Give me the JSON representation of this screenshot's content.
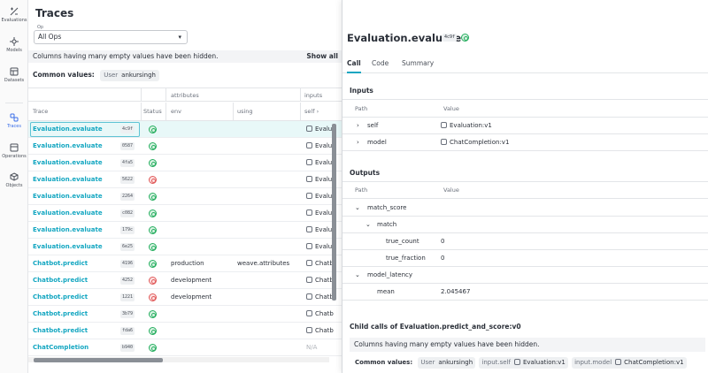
{
  "rail": [
    {
      "label": "Evaluations",
      "icon": "evaluations-icon"
    },
    {
      "label": "Models",
      "icon": "models-icon"
    },
    {
      "label": "Datasets",
      "icon": "datasets-icon"
    },
    {
      "label": "Traces",
      "icon": "traces-icon"
    },
    {
      "label": "Operations",
      "icon": "operations-icon"
    },
    {
      "label": "Objects",
      "icon": "objects-icon"
    }
  ],
  "traces": {
    "title": "Traces",
    "op_label": "Op",
    "op_value": "All Ops",
    "banner": "Columns having many empty values have been hidden.",
    "show_all": "Show all",
    "common_values_label": "Common values:",
    "common_chip_key": "User",
    "common_chip_value": "ankursingh",
    "group_attributes": "attributes",
    "group_inputs": "inputs",
    "col_trace": "Trace",
    "col_status": "Status",
    "col_env": "env",
    "col_using": "using",
    "col_self": "self",
    "rows": [
      {
        "name": "Evaluation.evaluate",
        "hash": "4c9f",
        "status": "ok",
        "env": "",
        "using": "",
        "self": "Evalua"
      },
      {
        "name": "Evaluation.evaluate",
        "hash": "0587",
        "status": "ok",
        "env": "",
        "using": "",
        "self": "Evalua"
      },
      {
        "name": "Evaluation.evaluate",
        "hash": "4fa5",
        "status": "ok",
        "env": "",
        "using": "",
        "self": "Evalua"
      },
      {
        "name": "Evaluation.evaluate",
        "hash": "5622",
        "status": "err",
        "env": "",
        "using": "",
        "self": "Evalua"
      },
      {
        "name": "Evaluation.evaluate",
        "hash": "2264",
        "status": "ok",
        "env": "",
        "using": "",
        "self": "Evalua"
      },
      {
        "name": "Evaluation.evaluate",
        "hash": "c082",
        "status": "ok",
        "env": "",
        "using": "",
        "self": "Evalua"
      },
      {
        "name": "Evaluation.evaluate",
        "hash": "179c",
        "status": "ok",
        "env": "",
        "using": "",
        "self": "Evalua"
      },
      {
        "name": "Evaluation.evaluate",
        "hash": "6e25",
        "status": "ok",
        "env": "",
        "using": "",
        "self": "Evalua"
      },
      {
        "name": "Chatbot.predict",
        "hash": "4196",
        "status": "ok",
        "env": "production",
        "using": "weave.attributes",
        "self": "Chatb"
      },
      {
        "name": "Chatbot.predict",
        "hash": "4252",
        "status": "err",
        "env": "development",
        "using": "",
        "self": "Chatb"
      },
      {
        "name": "Chatbot.predict",
        "hash": "1221",
        "status": "err",
        "env": "development",
        "using": "",
        "self": "Chatb"
      },
      {
        "name": "Chatbot.predict",
        "hash": "3b79",
        "status": "ok",
        "env": "",
        "using": "",
        "self": "Chatb"
      },
      {
        "name": "Chatbot.predict",
        "hash": "fda6",
        "status": "ok",
        "env": "",
        "using": "",
        "self": "Chatb"
      },
      {
        "name": "ChatCompletion",
        "hash": "b940",
        "status": "ok",
        "env": "",
        "using": "",
        "self": "N/A"
      }
    ]
  },
  "drawer": {
    "title": "Evaluation.evaluate",
    "hash": "4c9f",
    "tabs": [
      "Call",
      "Code",
      "Summary"
    ],
    "inputs_heading": "Inputs",
    "col_path": "Path",
    "col_value": "Value",
    "inputs": [
      {
        "path": "self",
        "value": "Evaluation:v1"
      },
      {
        "path": "model",
        "value": "ChatCompletion:v1"
      }
    ],
    "outputs_heading": "Outputs",
    "outputs": [
      {
        "path": "match_score",
        "value": "",
        "indent": 0,
        "expanded": true
      },
      {
        "path": "match",
        "value": "",
        "indent": 1,
        "expanded": true
      },
      {
        "path": "true_count",
        "value": "0",
        "indent": 2,
        "expanded": false
      },
      {
        "path": "true_fraction",
        "value": "0",
        "indent": 2,
        "expanded": false
      },
      {
        "path": "model_latency",
        "value": "",
        "indent": 0,
        "expanded": true
      },
      {
        "path": "mean",
        "value": "2.045467",
        "indent": 1,
        "expanded": false
      }
    ],
    "child_heading": "Child calls of Evaluation.predict_and_score:v0",
    "child_banner": "Columns having many empty values have been hidden.",
    "common_values_label": "Common values:",
    "common_chips": [
      {
        "key": "User",
        "value": "ankursingh",
        "icon": false
      },
      {
        "key": "input.self",
        "value": "Evaluation:v1",
        "icon": true
      },
      {
        "key": "input.model",
        "value": "ChatCompletion:v1",
        "icon": true
      }
    ]
  },
  "colors": {
    "accent": "#13a6c1",
    "ok": "#27ae60",
    "error": "#e05a5a"
  }
}
